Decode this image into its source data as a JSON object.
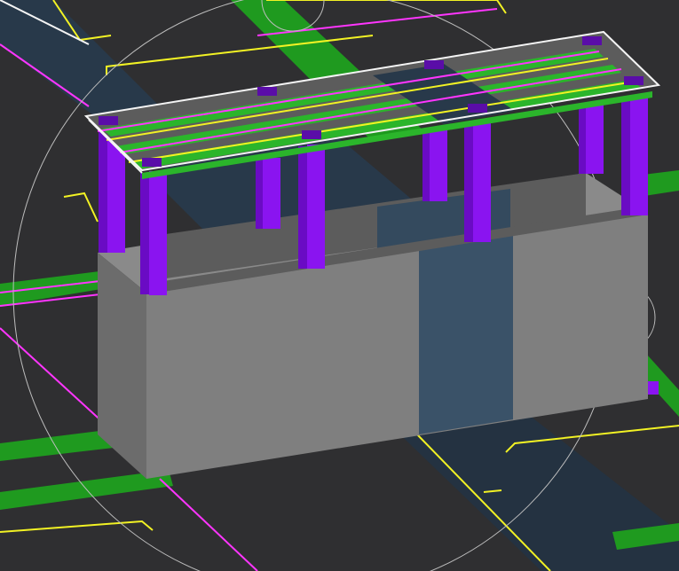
{
  "viewport": {
    "visual_style": "shaded-3d",
    "colors": {
      "background": "#2f2f31",
      "road_green": "#1f9a1f",
      "road_green_light": "#2bb52b",
      "road_blue": "#28394a",
      "road_blue_dark": "#243241",
      "line_magenta": "#ff35ff",
      "line_yellow": "#f2f224",
      "line_white": "#f4f4f4",
      "pillar_purple_front": "#8a14f0",
      "pillar_purple_side": "#6a0bc4",
      "pillar_purple_top": "#5a0da8",
      "wall_front": "#7f7f7f",
      "wall_side": "#6c6c6c",
      "wall_top": "#8a8a8a",
      "wall_dark_strip": "#5c5c5c",
      "wall_blue_panel": "#3a5268",
      "wall_blue_panel_dark": "#344a5e",
      "grid_circle": "#bdbdbd"
    },
    "icons": {
      "orbit_circle": "orbit-circle-icon",
      "compass_circle": "small-orbit-circle-icon"
    },
    "model": {
      "wall": "solid-wall",
      "columns": "column-group",
      "canopy": "canopy-frame"
    }
  }
}
